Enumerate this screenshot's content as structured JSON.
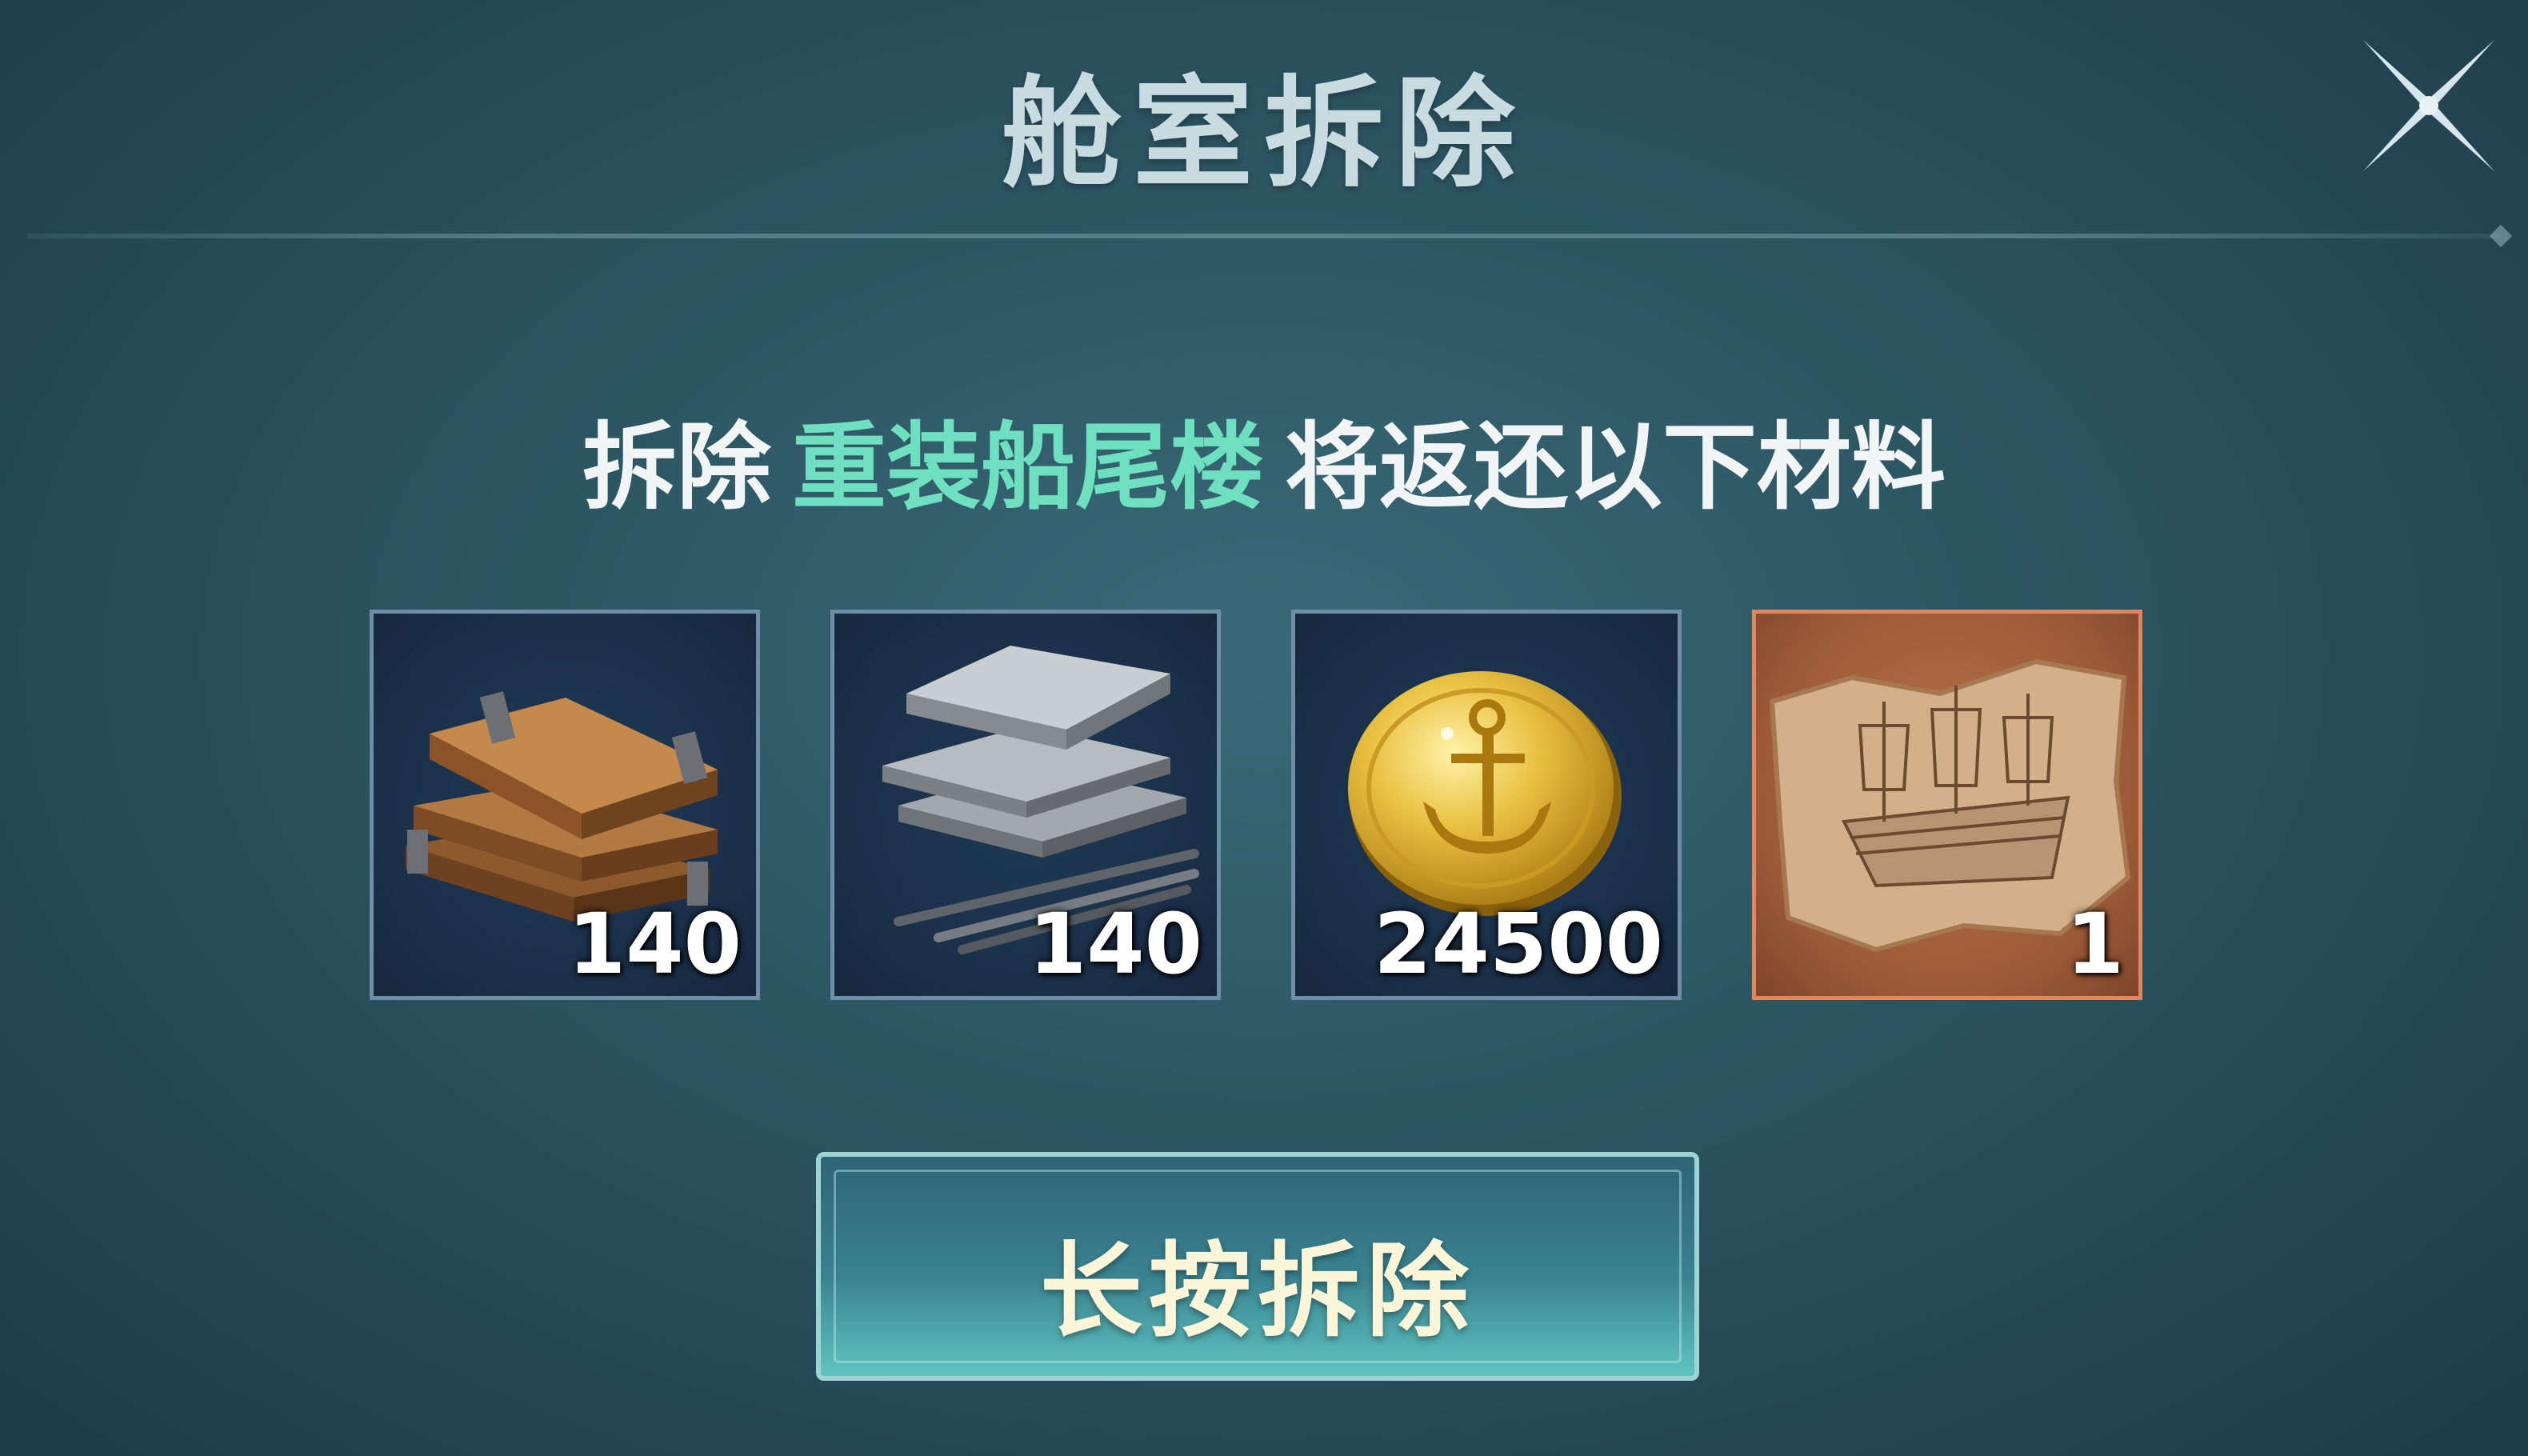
{
  "dialog": {
    "title": "舱室拆除"
  },
  "message": {
    "prefix": "拆除",
    "highlight": "重装船尾楼",
    "suffix": "将返还以下材料"
  },
  "items": [
    {
      "icon": "wood-planks-icon",
      "count": "140"
    },
    {
      "icon": "steel-plates-icon",
      "count": "140"
    },
    {
      "icon": "gold-anchor-coin-icon",
      "count": "24500"
    },
    {
      "icon": "ship-blueprint-icon",
      "count": "1"
    }
  ],
  "confirm_button": {
    "label": "长按拆除"
  },
  "colors": {
    "highlight": "#6ee0bf",
    "special_border": "#e1875d"
  }
}
